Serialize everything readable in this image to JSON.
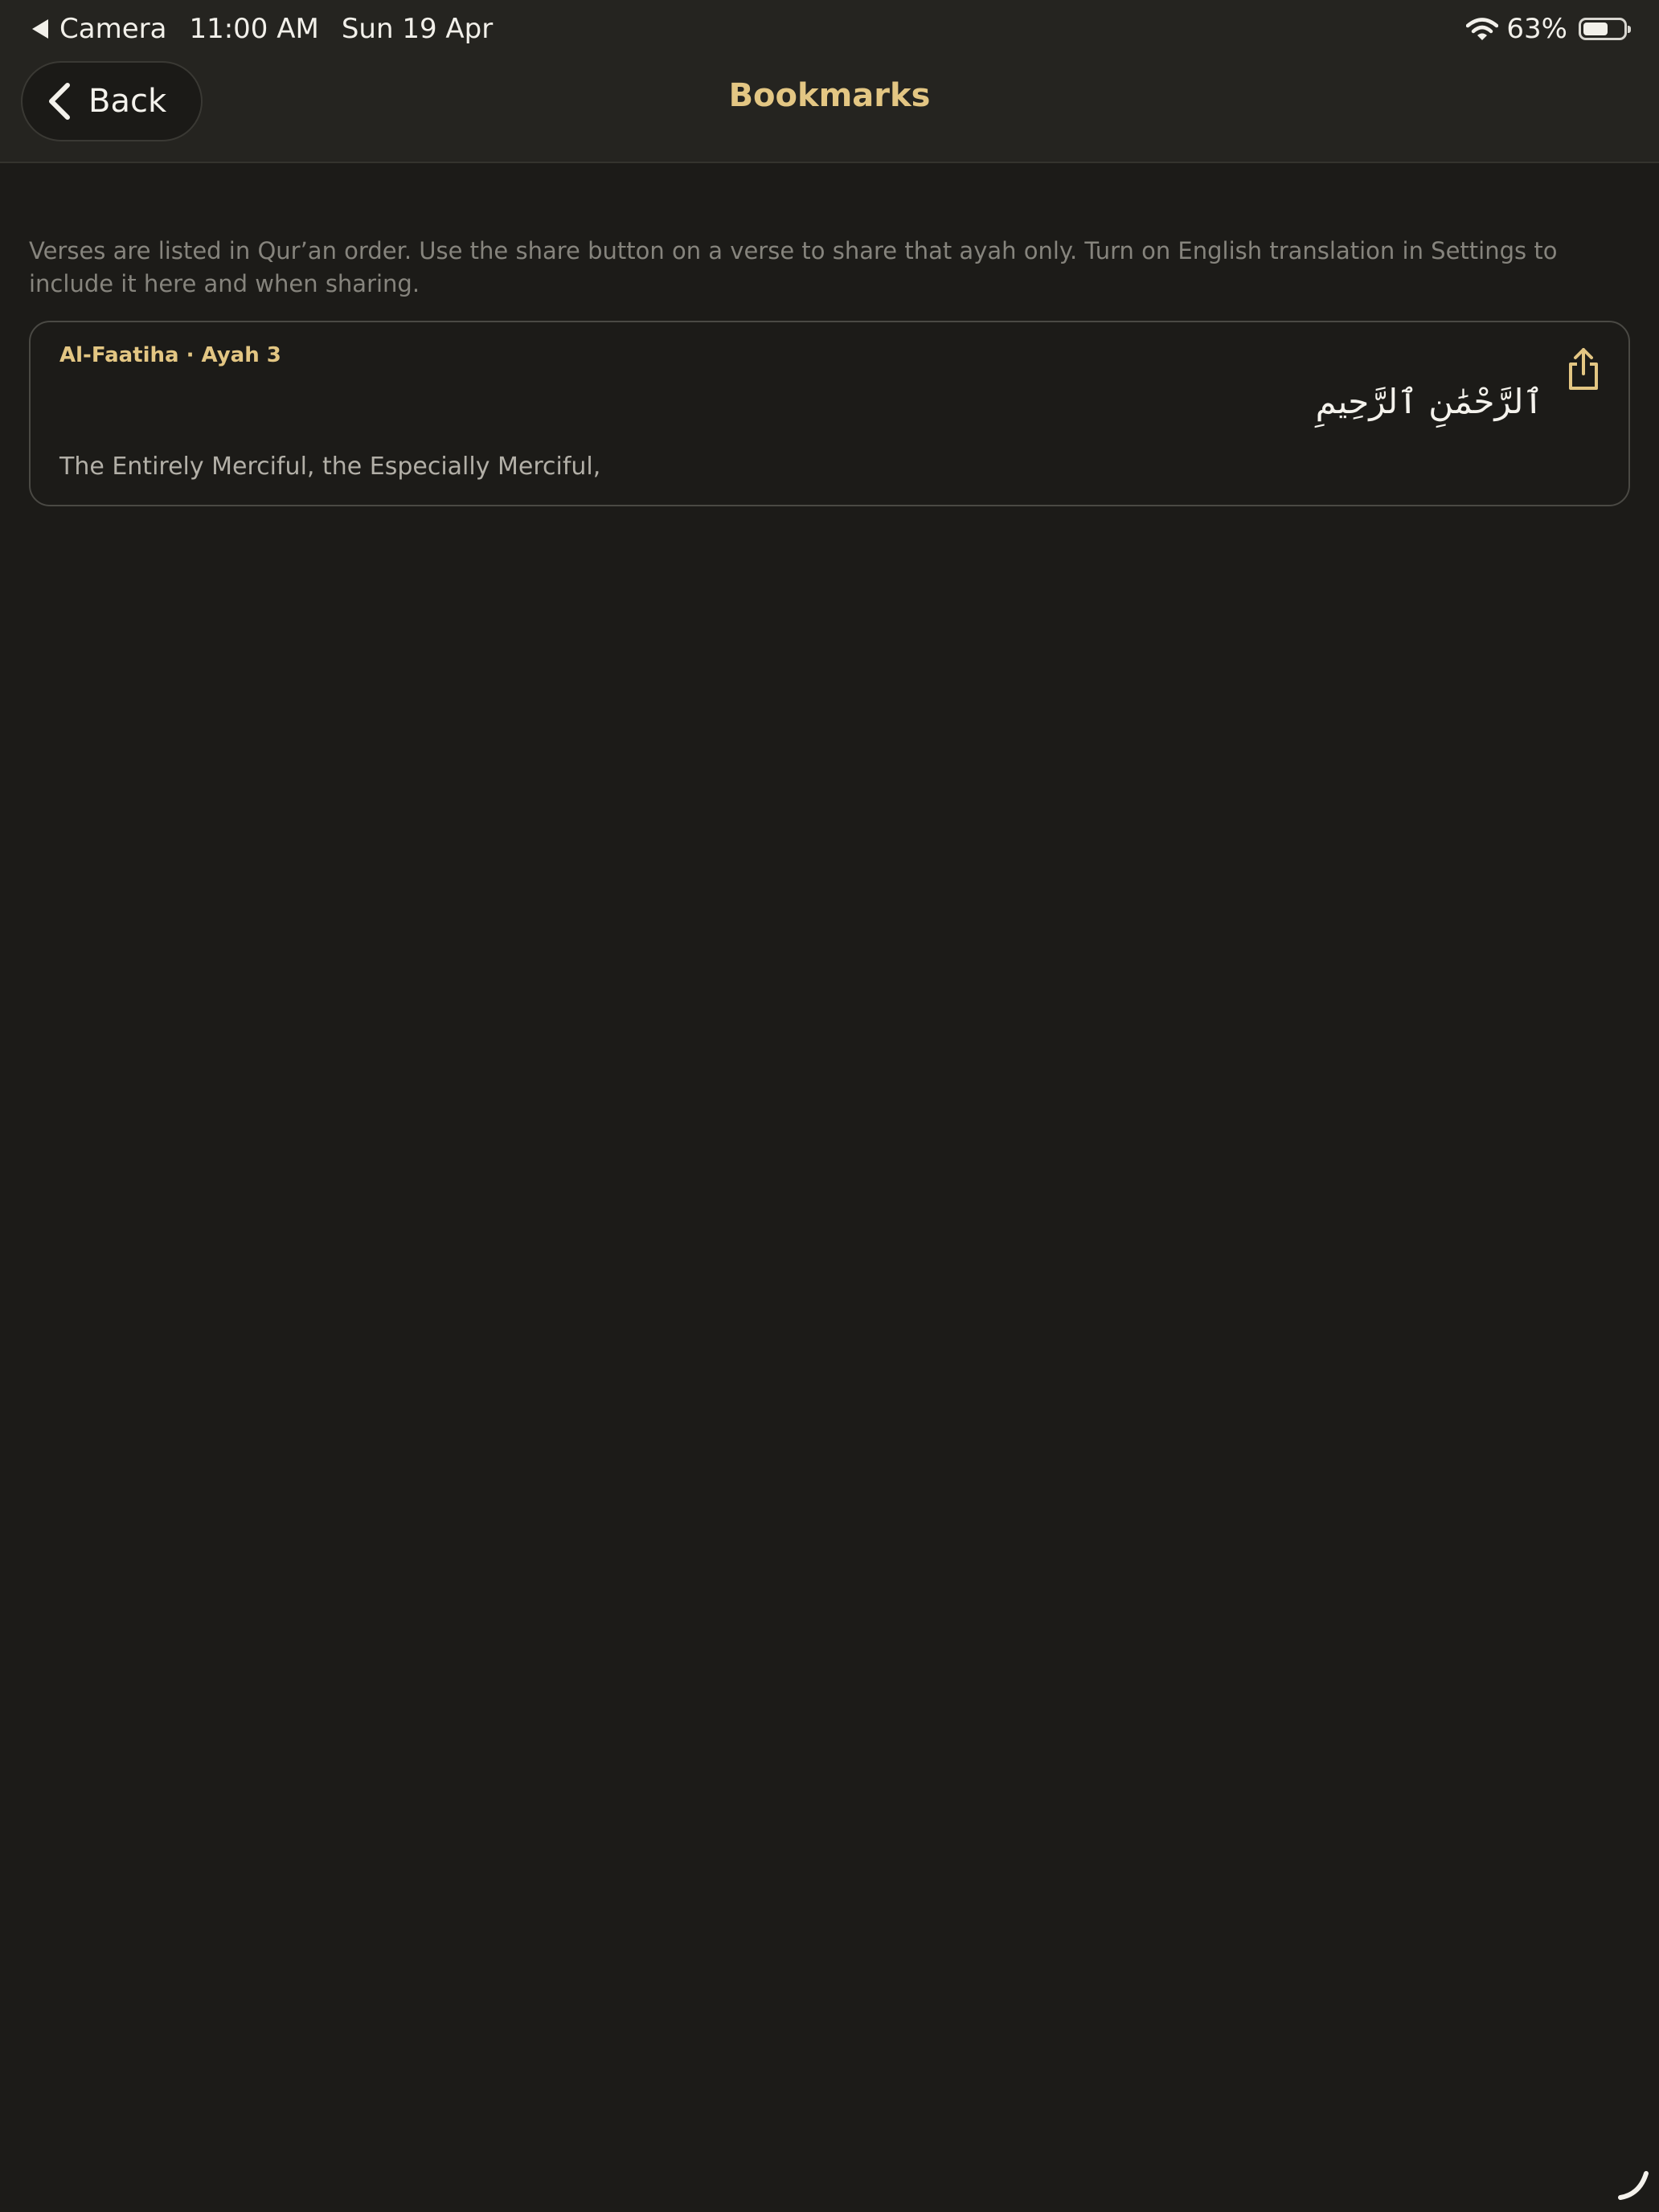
{
  "status_bar": {
    "return_app": "Camera",
    "time": "11:00 AM",
    "date": "Sun 19 Apr",
    "battery_percent": "63%",
    "battery_level": 0.63
  },
  "nav": {
    "back_label": "Back",
    "title": "Bookmarks"
  },
  "intro": "Verses are listed in Qur’an order. Use the share button on a verse to share that ayah only. Turn on English translation in Settings to include it here and when sharing.",
  "bookmarks": [
    {
      "reference": "Al-Faatiha · Ayah 3",
      "arabic": "ٱلرَّحْمَٰنِ ٱلرَّحِيمِ",
      "translation": "The Entirely Merciful, the Especially Merciful,"
    }
  ],
  "colors": {
    "accent": "#e3c683",
    "background": "#1c1b18",
    "header": "#252420",
    "muted_text": "#86847d"
  },
  "icons": {
    "back": "chevron-left-icon",
    "share": "share-icon",
    "wifi": "wifi-icon",
    "battery": "battery-icon"
  }
}
